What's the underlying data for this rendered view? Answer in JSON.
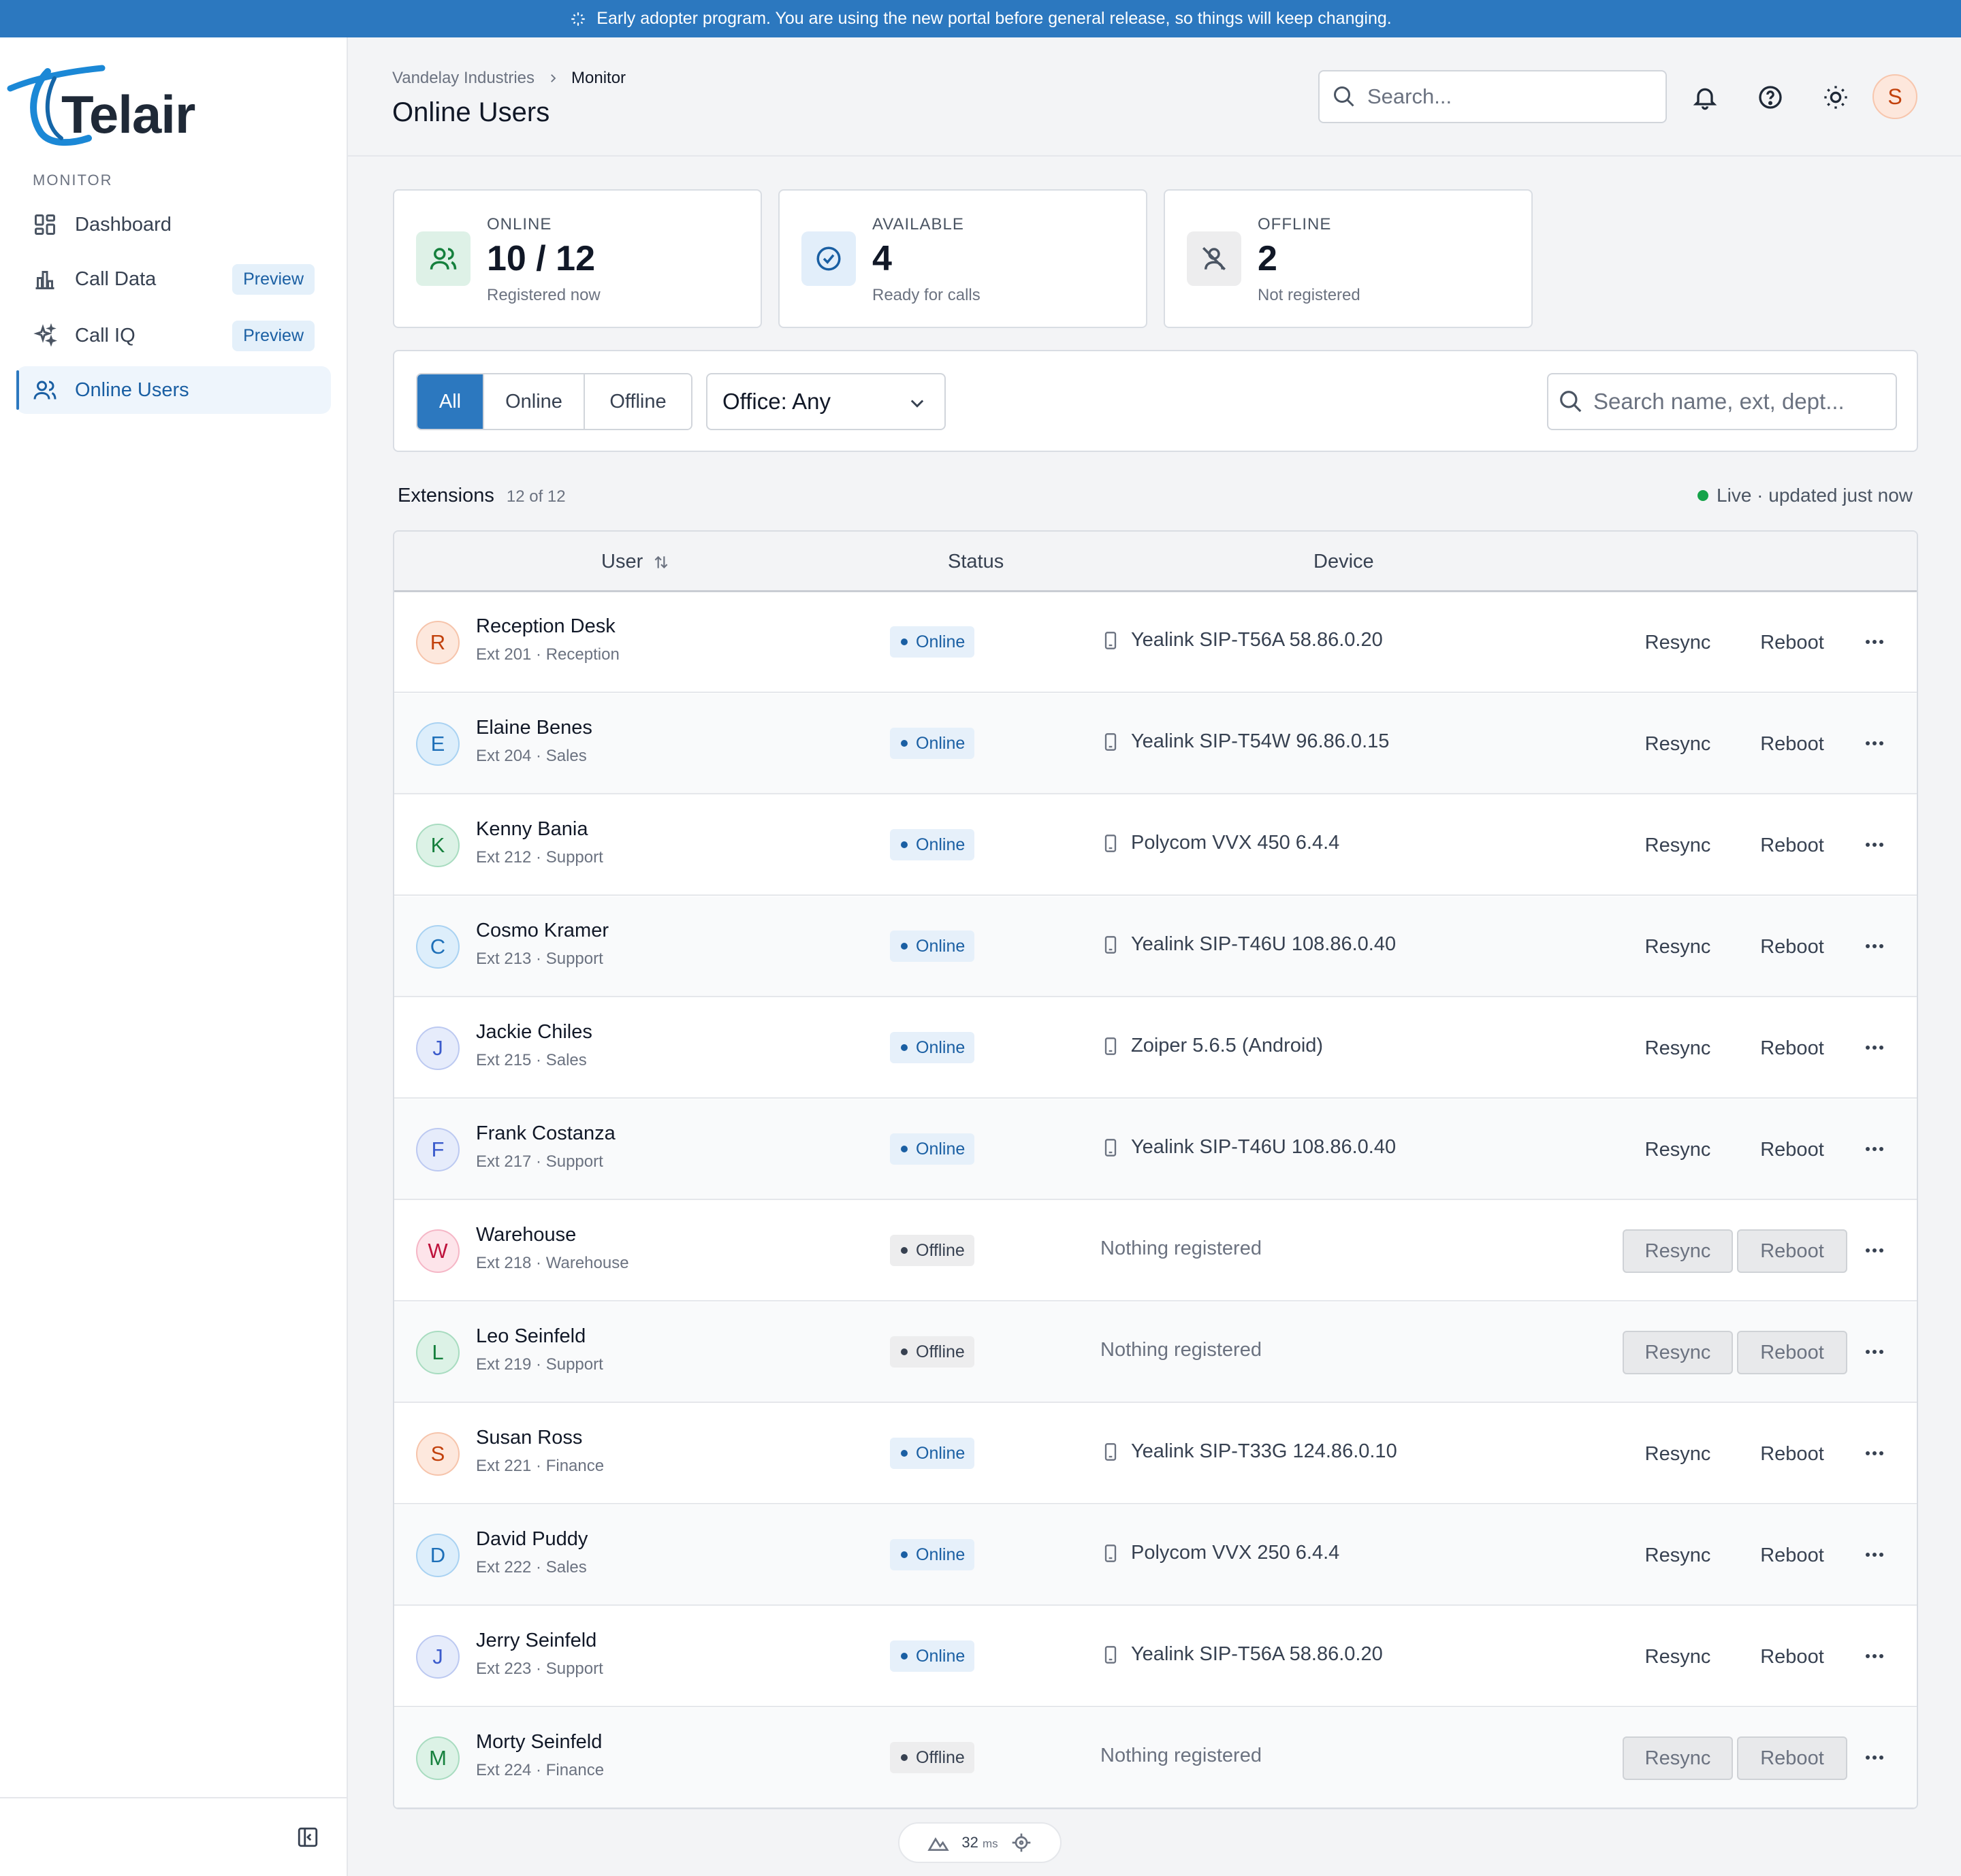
{
  "banner": {
    "text": "Early adopter program. You are using the new portal before general release, so things will keep changing."
  },
  "brand": {
    "name": "Telair"
  },
  "sidebar": {
    "section": "MONITOR",
    "items": [
      {
        "label": "Dashboard",
        "icon": "dashboard-grid-icon"
      },
      {
        "label": "Call Data",
        "icon": "bar-chart-icon",
        "badge": "Preview"
      },
      {
        "label": "Call IQ",
        "icon": "sparkles-icon",
        "badge": "Preview"
      },
      {
        "label": "Online Users",
        "icon": "users-icon",
        "active": true
      }
    ]
  },
  "header": {
    "breadcrumb": [
      "Vandelay Industries",
      "Monitor"
    ],
    "title": "Online Users",
    "search_placeholder": "Search...",
    "avatar_initial": "S"
  },
  "stats": [
    {
      "label": "ONLINE",
      "value": "10 / 12",
      "sub": "Registered now"
    },
    {
      "label": "AVAILABLE",
      "value": "4",
      "sub": "Ready for calls"
    },
    {
      "label": "OFFLINE",
      "value": "2",
      "sub": "Not registered"
    }
  ],
  "filters": {
    "tabs": [
      "All",
      "Online",
      "Offline"
    ],
    "selected_tab": "All",
    "office": "Office: Any",
    "search_placeholder": "Search name, ext, dept..."
  },
  "extensions": {
    "title": "Extensions",
    "count": "12 of 12",
    "live": "Live · updated just now",
    "columns": {
      "user": "User",
      "status": "Status",
      "device": "Device"
    },
    "actions": {
      "resync": "Resync",
      "reboot": "Reboot"
    },
    "rows": [
      {
        "initial": "R",
        "name": "Reception Desk",
        "meta": "Ext 201 · Reception",
        "status": "Online",
        "device": "Yealink SIP-T56A 58.86.0.20"
      },
      {
        "initial": "E",
        "name": "Elaine Benes",
        "meta": "Ext 204 · Sales",
        "status": "Online",
        "device": "Yealink SIP-T54W 96.86.0.15"
      },
      {
        "initial": "K",
        "name": "Kenny Bania",
        "meta": "Ext 212 · Support",
        "status": "Online",
        "device": "Polycom VVX 450 6.4.4"
      },
      {
        "initial": "C",
        "name": "Cosmo Kramer",
        "meta": "Ext 213 · Support",
        "status": "Online",
        "device": "Yealink SIP-T46U 108.86.0.40"
      },
      {
        "initial": "J",
        "name": "Jackie Chiles",
        "meta": "Ext 215 · Sales",
        "status": "Online",
        "device": "Zoiper 5.6.5 (Android)"
      },
      {
        "initial": "F",
        "name": "Frank Costanza",
        "meta": "Ext 217 · Support",
        "status": "Online",
        "device": "Yealink SIP-T46U 108.86.0.40"
      },
      {
        "initial": "W",
        "name": "Warehouse",
        "meta": "Ext 218 · Warehouse",
        "status": "Offline",
        "device": "Nothing registered"
      },
      {
        "initial": "L",
        "name": "Leo Seinfeld",
        "meta": "Ext 219 · Support",
        "status": "Offline",
        "device": "Nothing registered"
      },
      {
        "initial": "S",
        "name": "Susan Ross",
        "meta": "Ext 221 · Finance",
        "status": "Online",
        "device": "Yealink SIP-T33G 124.86.0.10"
      },
      {
        "initial": "D",
        "name": "David Puddy",
        "meta": "Ext 222 · Sales",
        "status": "Online",
        "device": "Polycom VVX 250 6.4.4"
      },
      {
        "initial": "J",
        "name": "Jerry Seinfeld",
        "meta": "Ext 223 · Support",
        "status": "Online",
        "device": "Yealink SIP-T56A 58.86.0.20"
      },
      {
        "initial": "M",
        "name": "Morty Seinfeld",
        "meta": "Ext 224 · Finance",
        "status": "Offline",
        "device": "Nothing registered"
      }
    ]
  },
  "perf": {
    "value": "32",
    "unit": "ms"
  }
}
